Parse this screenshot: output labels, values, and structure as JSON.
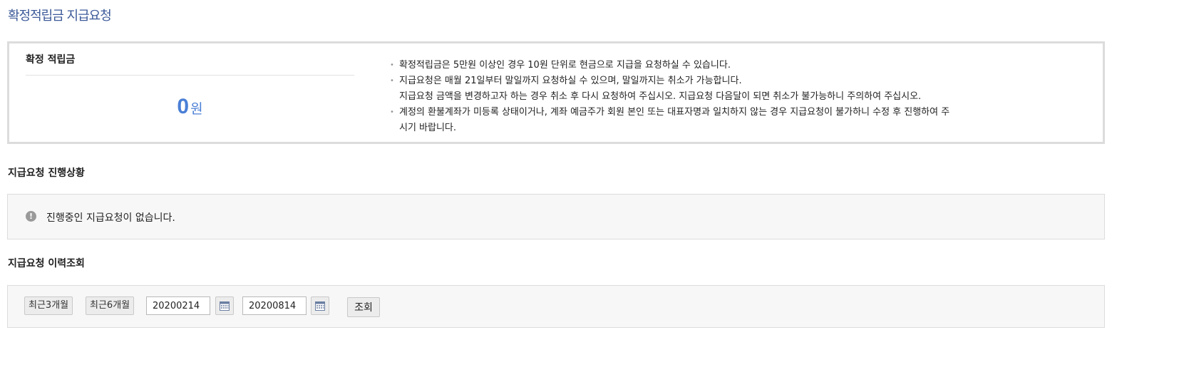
{
  "page": {
    "title": "확정적립금 지급요청"
  },
  "balance": {
    "label": "확정 적립금",
    "amount": "0",
    "unit": "원"
  },
  "notices": [
    {
      "line1": "확정적립금은 5만원 이상인 경우 10원 단위로 현금으로 지급을 요청하실 수 있습니다.",
      "line2": ""
    },
    {
      "line1": "지급요청은 매월 21일부터 말일까지 요청하실 수 있으며, 말일까지는 취소가 가능합니다.",
      "line2": "지급요청 금액을 변경하고자 하는 경우 취소 후 다시 요청하여 주십시오. 지급요청 다음달이 되면 취소가 불가능하니 주의하여 주십시오."
    },
    {
      "line1": "계정의 환불계좌가 미등록 상태이거나, 계좌 예금주가 회원 본인 또는 대표자명과 일치하지 않는 경우 지급요청이 불가하니 수정 후 진행하여 주",
      "line2": "시기 바랍니다."
    }
  ],
  "status": {
    "section_title": "지급요청 진행상황",
    "message": "진행중인 지급요청이 없습니다.",
    "icon": "exclamation-circle-icon"
  },
  "history": {
    "section_title": "지급요청 이력조회",
    "btn_3months": "최근3개월",
    "btn_6months": "최근6개월",
    "start_date": "20200214",
    "end_date": "20200814",
    "search_label": "조회",
    "calendar_icon": "calendar-icon"
  },
  "colors": {
    "title": "#3c5a99",
    "amount": "#4a7fd6"
  }
}
